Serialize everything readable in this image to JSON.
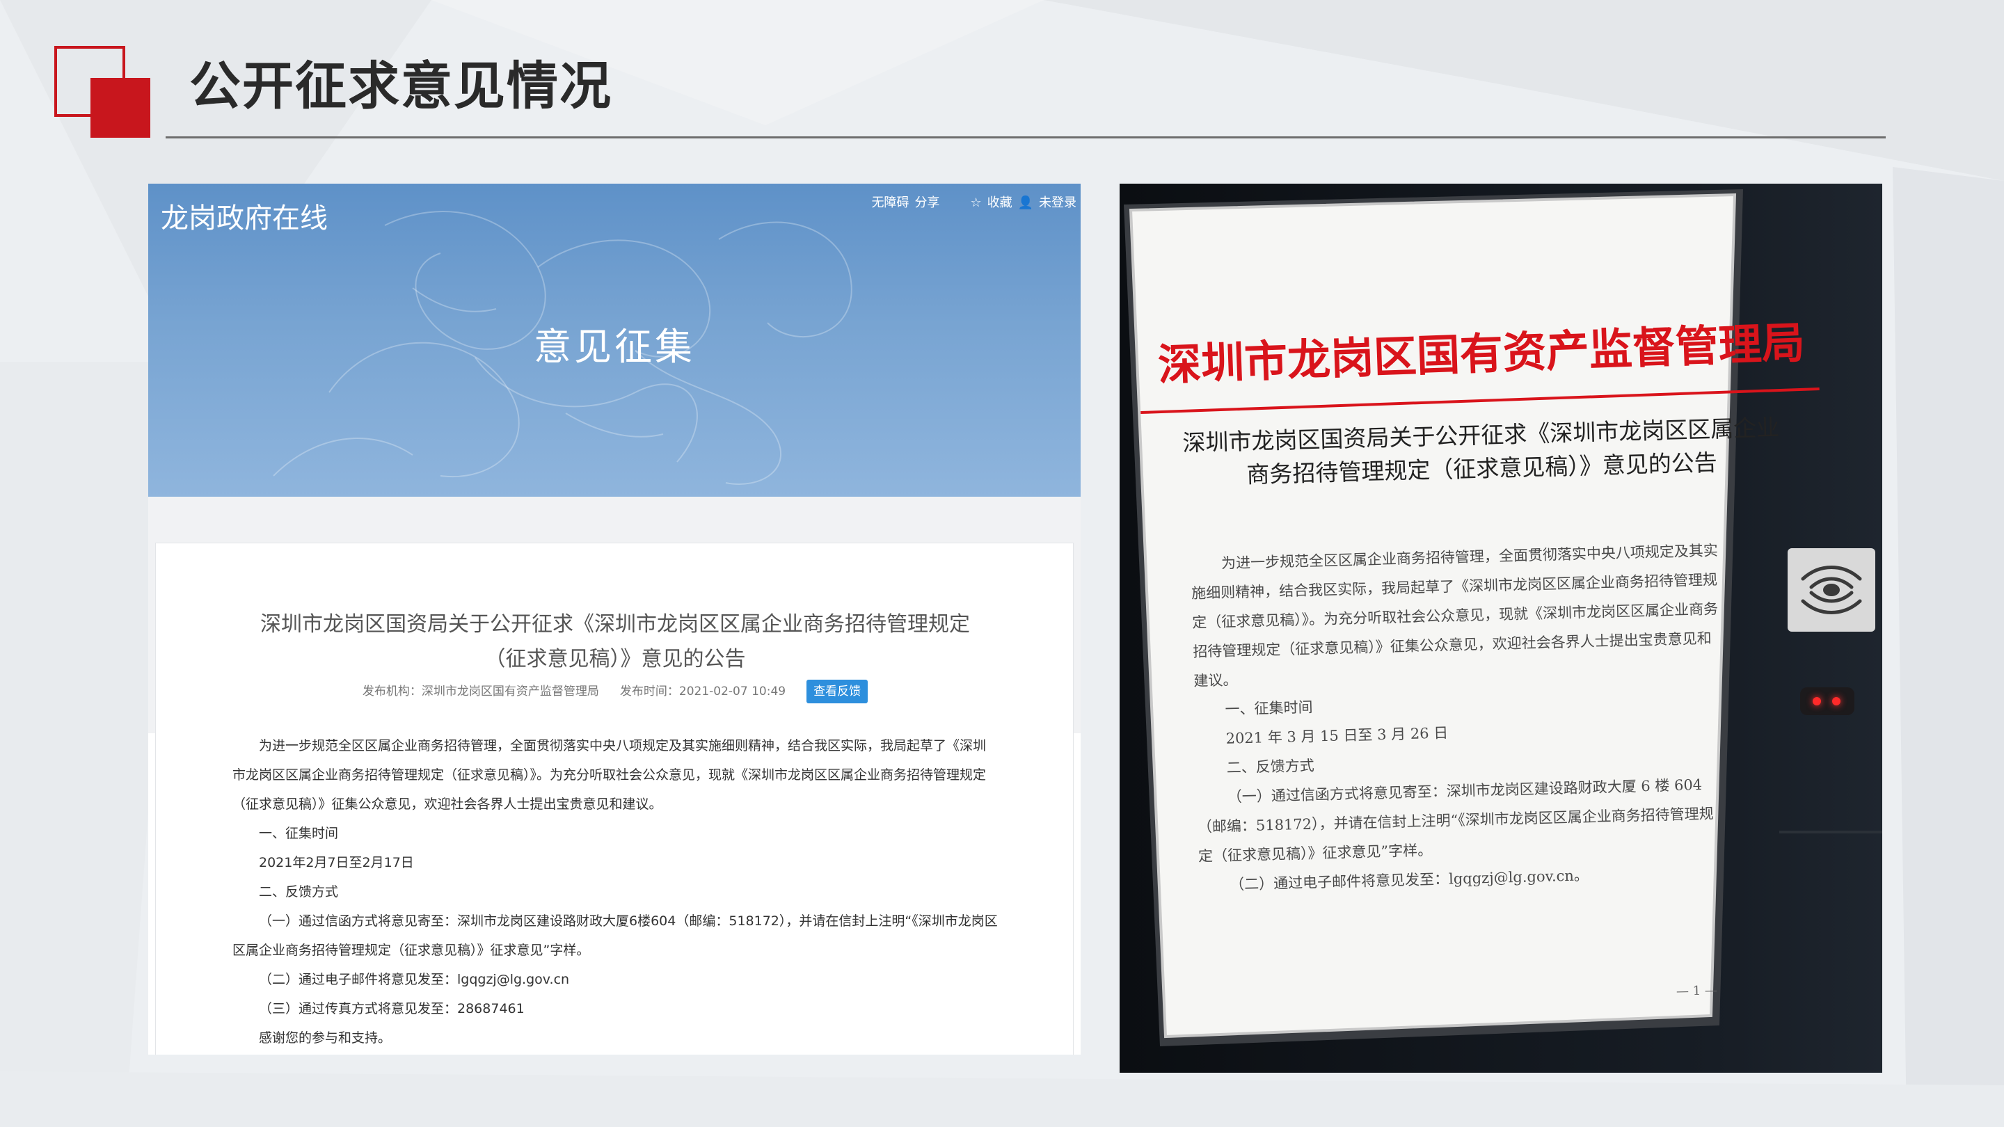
{
  "slide": {
    "title": "公开征求意见情况",
    "accent_color": "#c8161d"
  },
  "website": {
    "site_name": "龙岗政府在线",
    "top_links": [
      "无障碍",
      "分享",
      "收藏",
      "未登录"
    ],
    "banner_title": "意见征集",
    "banner_color": "#6a9bcd",
    "article": {
      "title": "深圳市龙岗区国资局关于公开征求《深圳市龙岗区区属企业商务招待管理规定 （征求意见稿）》意见的公告",
      "publisher": "发布机构：深圳市龙岗区国有资产监督管理局",
      "published_time": "发布时间：2021-02-07 10:49",
      "feedback_button": "查看反馈",
      "paragraphs": [
        "为进一步规范全区区属企业商务招待管理，全面贯彻落实中央八项规定及其实施细则精神，结合我区实际，我局起草了《深圳市龙岗区区属企业商务招待管理规定（征求意见稿）》。为充分听取社会公众意见，现就《深圳市龙岗区区属企业商务招待管理规定（征求意见稿）》征集公众意见，欢迎社会各界人士提出宝贵意见和建议。",
        "一、征集时间",
        "2021年2月7日至2月17日",
        "二、反馈方式",
        "（一）通过信函方式将意见寄至：深圳市龙岗区建设路财政大厦6楼604（邮编：518172），并请在信封上注明“《深圳市龙岗区区属企业商务招待管理规定（征求意见稿）》征求意见”字样。",
        "（二）通过电子邮件将意见发至：lgqgzj@lg.gov.cn",
        "（三）通过传真方式将意见发至：28687461",
        "感谢您的参与和支持。"
      ]
    }
  },
  "photo_notice": {
    "organization": "深圳市龙岗区国有资产监督管理局",
    "title": "深圳市龙岗区国资局关于公开征求《深圳市龙岗区区属企业商务招待管理规定（征求意见稿）》意见的公告",
    "paragraphs": [
      "为进一步规范全区区属企业商务招待管理，全面贯彻落实中央八项规定及其实施细则精神，结合我区实际，我局起草了《深圳市龙岗区区属企业商务招待管理规定（征求意见稿）》。为充分听取社会公众意见，现就《深圳市龙岗区区属企业商务招待管理规定（征求意见稿）》征集公众意见，欢迎社会各界人士提出宝贵意见和建议。",
      "一、征集时间",
      "2021 年 3 月 15 日至 3 月 26 日",
      "二、反馈方式",
      "（一）通过信函方式将意见寄至：深圳市龙岗区建设路财政大厦 6 楼 604（邮编：518172），并请在信封上注明“《深圳市龙岗区区属企业商务招待管理规定（征求意见稿）》征求意见”字样。",
      "（二）通过电子邮件将意见发至：lgqgzj@lg.gov.cn。"
    ],
    "page_number": "— 1 —",
    "org_color": "#d9141b"
  }
}
